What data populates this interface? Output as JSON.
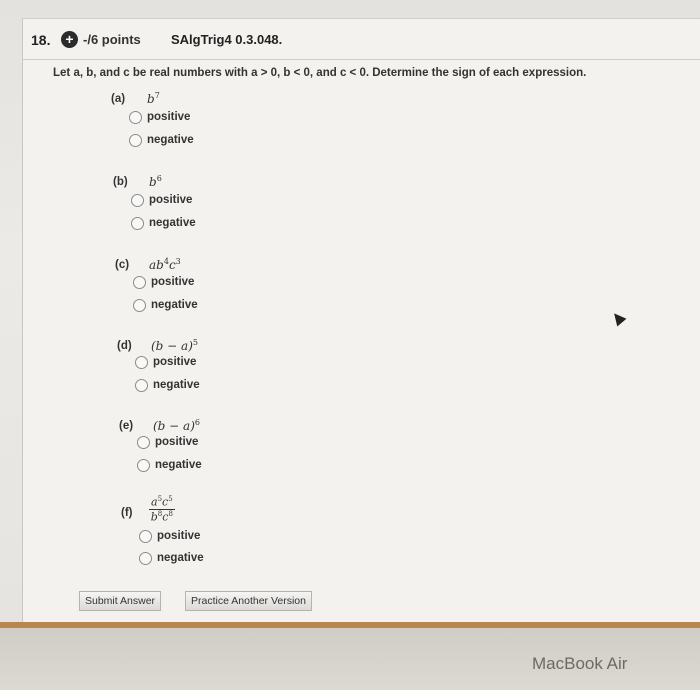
{
  "question": {
    "number": "18.",
    "points": "-/6 points",
    "code": "SAlgTrig4 0.3.048.",
    "instructions": "Let a, b, and c be real numbers with a > 0, b < 0, and c < 0. Determine the sign of each expression."
  },
  "parts": [
    {
      "label": "(a)",
      "expr": "b",
      "sup": "7"
    },
    {
      "label": "(b)",
      "expr": "b",
      "sup": "6"
    },
    {
      "label": "(c)",
      "expr_html": "ab4c3"
    },
    {
      "label": "(d)",
      "expr": "(b − a)",
      "sup": "5"
    },
    {
      "label": "(e)",
      "expr": "(b − a)",
      "sup": "6"
    },
    {
      "label": "(f)"
    }
  ],
  "options": {
    "positive": "positive",
    "negative": "negative"
  },
  "buttons": {
    "submit": "Submit Answer",
    "practice": "Practice Another Version"
  },
  "device": {
    "brand": "MacBook Air"
  }
}
